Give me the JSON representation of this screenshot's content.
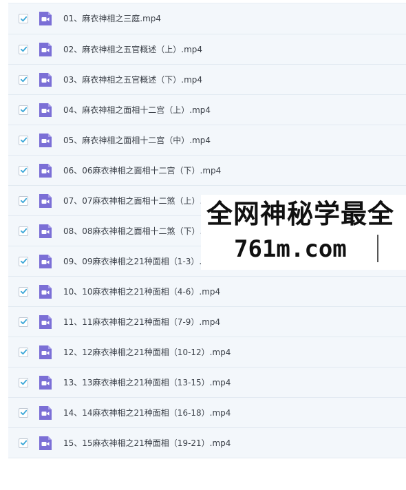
{
  "files": [
    {
      "name": "01、麻衣神相之三庭.mp4",
      "checked": true
    },
    {
      "name": "02、麻衣神相之五官概述（上）.mp4",
      "checked": true
    },
    {
      "name": "03、麻衣神相之五官概述（下）.mp4",
      "checked": true
    },
    {
      "name": "04、麻衣神相之面相十二宫（上）.mp4",
      "checked": true
    },
    {
      "name": "05、麻衣神相之面相十二宫（中）.mp4",
      "checked": true
    },
    {
      "name": "06、06麻衣神相之面相十二宫（下）.mp4",
      "checked": true
    },
    {
      "name": "07、07麻衣神相之面相十二煞（上）.mp4",
      "checked": true
    },
    {
      "name": "08、08麻衣神相之面相十二煞（下）.mp4",
      "checked": true
    },
    {
      "name": "09、09麻衣神相之21种面相（1-3）.mp4",
      "checked": true
    },
    {
      "name": "10、10麻衣神相之21种面相（4-6）.mp4",
      "checked": true
    },
    {
      "name": "11、11麻衣神相之21种面相（7-9）.mp4",
      "checked": true
    },
    {
      "name": "12、12麻衣神相之21种面相（10-12）.mp4",
      "checked": true
    },
    {
      "name": "13、13麻衣神相之21种面相（13-15）.mp4",
      "checked": true
    },
    {
      "name": "14、14麻衣神相之21种面相（16-18）.mp4",
      "checked": true
    },
    {
      "name": "15、15麻衣神相之21种面相（19-21）.mp4",
      "checked": true
    }
  ],
  "watermark": {
    "line1": "全网神秘学最全",
    "line2": "761m.com"
  },
  "colors": {
    "check": "#3ba7d8",
    "video_icon": "#7b6fd6",
    "row_bg": "#f3f7fb"
  },
  "icons": {
    "checkbox": "checkmark-icon",
    "file": "video-file-icon"
  }
}
